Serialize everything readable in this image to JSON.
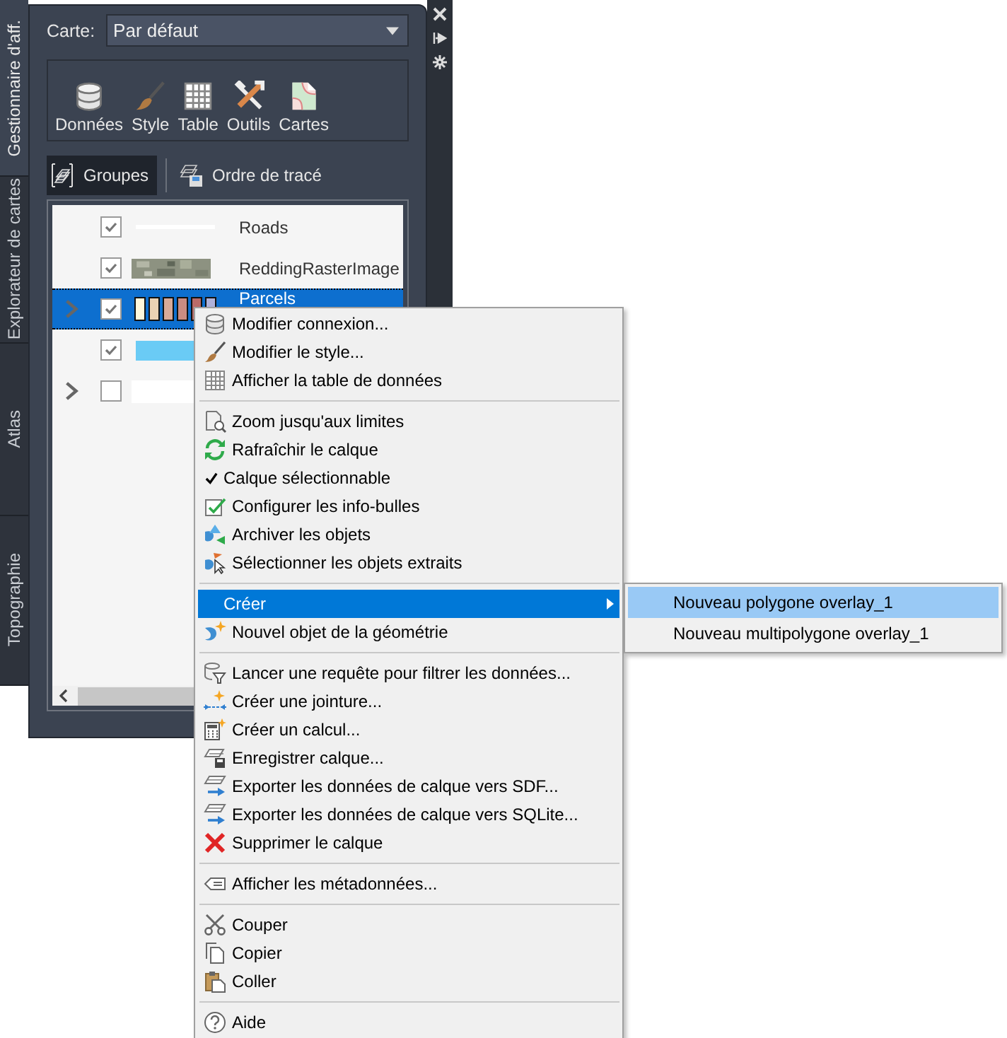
{
  "side_tabs": [
    {
      "label": "Gestionnaire d'aff.",
      "selected": true
    },
    {
      "label": "Explorateur de cartes",
      "selected": false
    },
    {
      "label": "Atlas",
      "selected": false
    },
    {
      "label": "Topographie",
      "selected": false
    }
  ],
  "map_selector": {
    "label": "Carte:",
    "value": "Par défaut"
  },
  "toolbar": [
    {
      "label": "Données"
    },
    {
      "label": "Style"
    },
    {
      "label": "Table"
    },
    {
      "label": "Outils"
    },
    {
      "label": "Cartes"
    }
  ],
  "view_tabs": [
    {
      "label": "Groupes",
      "selected": true
    },
    {
      "label": "Ordre de tracé",
      "selected": false
    }
  ],
  "layers": [
    {
      "name": "Roads",
      "checked": true,
      "expandable": false,
      "selected": false,
      "kind": "line"
    },
    {
      "name": "ReddingRasterImage",
      "checked": true,
      "expandable": false,
      "selected": false,
      "kind": "raster"
    },
    {
      "name": "Parcels",
      "checked": true,
      "expandable": true,
      "selected": true,
      "kind": "ramp"
    },
    {
      "checked": true,
      "expandable": false,
      "selected": false,
      "kind": "fill"
    },
    {
      "checked": false,
      "expandable": true,
      "selected": false,
      "kind": "blank"
    }
  ],
  "context_menu": [
    {
      "kind": "item",
      "label": "Modifier connexion...",
      "selected": false
    },
    {
      "kind": "item",
      "label": "Modifier le style...",
      "selected": false
    },
    {
      "kind": "item",
      "label": "Afficher la table de données",
      "selected": false
    },
    {
      "kind": "separator"
    },
    {
      "kind": "item",
      "label": "Zoom jusqu'aux limites",
      "selected": false
    },
    {
      "kind": "item",
      "label": "Rafraîchir le calque",
      "selected": false
    },
    {
      "kind": "check",
      "label": "Calque sélectionnable",
      "checked": true,
      "selected": false
    },
    {
      "kind": "item",
      "label": "Configurer les info-bulles",
      "selected": false
    },
    {
      "kind": "item",
      "label": "Archiver les objets",
      "selected": false
    },
    {
      "kind": "item",
      "label": "Sélectionner les objets extraits",
      "selected": false
    },
    {
      "kind": "separator"
    },
    {
      "kind": "submenu",
      "label": "Créer",
      "selected": true
    },
    {
      "kind": "item",
      "label": "Nouvel objet de la géométrie",
      "selected": false
    },
    {
      "kind": "separator"
    },
    {
      "kind": "item",
      "label": "Lancer une requête pour filtrer les données...",
      "selected": false
    },
    {
      "kind": "item",
      "label": "Créer une jointure...",
      "selected": false
    },
    {
      "kind": "item",
      "label": "Créer un calcul...",
      "selected": false
    },
    {
      "kind": "item",
      "label": "Enregistrer calque...",
      "selected": false
    },
    {
      "kind": "item",
      "label": "Exporter les données de calque vers SDF...",
      "selected": false
    },
    {
      "kind": "item",
      "label": "Exporter les données de calque vers SQLite...",
      "selected": false
    },
    {
      "kind": "item",
      "label": "Supprimer le calque",
      "selected": false
    },
    {
      "kind": "separator"
    },
    {
      "kind": "item",
      "label": "Afficher les métadonnées...",
      "selected": false
    },
    {
      "kind": "separator"
    },
    {
      "kind": "item",
      "label": "Couper",
      "selected": false
    },
    {
      "kind": "item",
      "label": "Copier",
      "selected": false
    },
    {
      "kind": "item",
      "label": "Coller",
      "selected": false
    },
    {
      "kind": "separator"
    },
    {
      "kind": "item",
      "label": "Aide",
      "selected": false
    }
  ],
  "submenu": [
    {
      "label": "Nouveau polygone overlay_1",
      "selected": true
    },
    {
      "label": "Nouveau multipolygone overlay_1",
      "selected": false
    }
  ]
}
